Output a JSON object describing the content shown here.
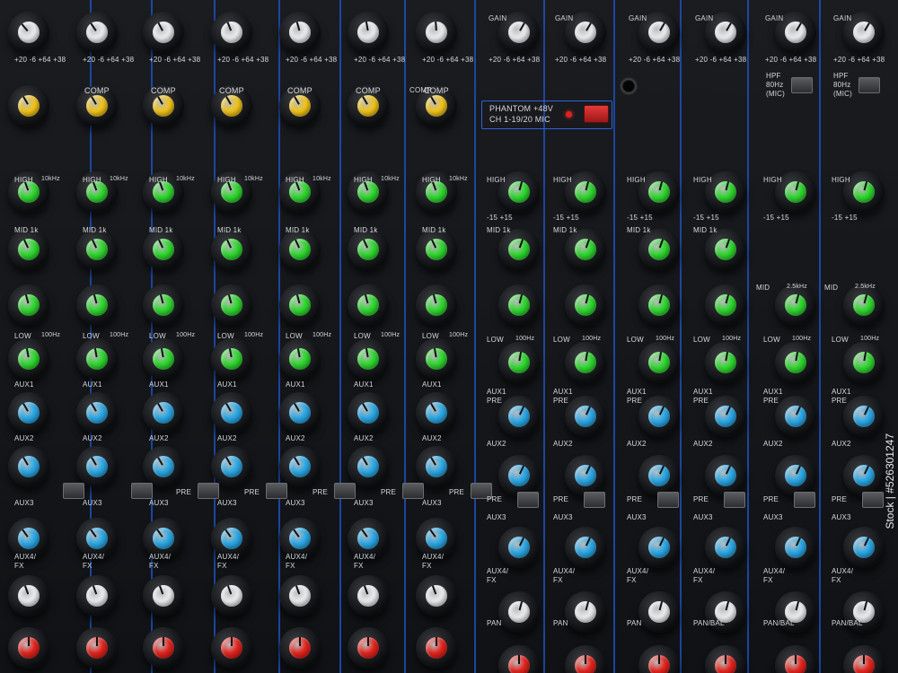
{
  "scene": {
    "subject": "Audio mixing console channel strips"
  },
  "colors": {
    "white_knob": "#ecedef",
    "yellow_knob": "#f2c419",
    "green_knob": "#2ed82e",
    "blue_knob": "#2aa8e6",
    "red_knob": "#e4231d",
    "strip_line": "#1e4fb8"
  },
  "labels": {
    "gain": "GAIN",
    "comp": "COMP",
    "high": "HIGH",
    "mid": "MID",
    "low": "LOW",
    "aux1": "AUX1",
    "pre": "PRE",
    "aux2": "AUX2",
    "aux3": "AUX3",
    "aux4": "AUX4/",
    "fx": "FX",
    "pan": "PAN",
    "pan_bal": "PAN/BAL",
    "hpf": "HPF",
    "hpf_freq": "80Hz",
    "hpf_mic": "(MIC)",
    "freq_10k": "10kHz",
    "freq_25k": "2.5kHz",
    "freq_100": "100Hz",
    "mid_1k": "MID 1k",
    "range_pm15": "-15      +15",
    "gain_range": "+20  -6  +64 +38"
  },
  "phantom": {
    "line1": "PHANTOM +48V",
    "line2": "CH 1-19/20 MIC"
  },
  "watermark": "Stock | #526301247"
}
